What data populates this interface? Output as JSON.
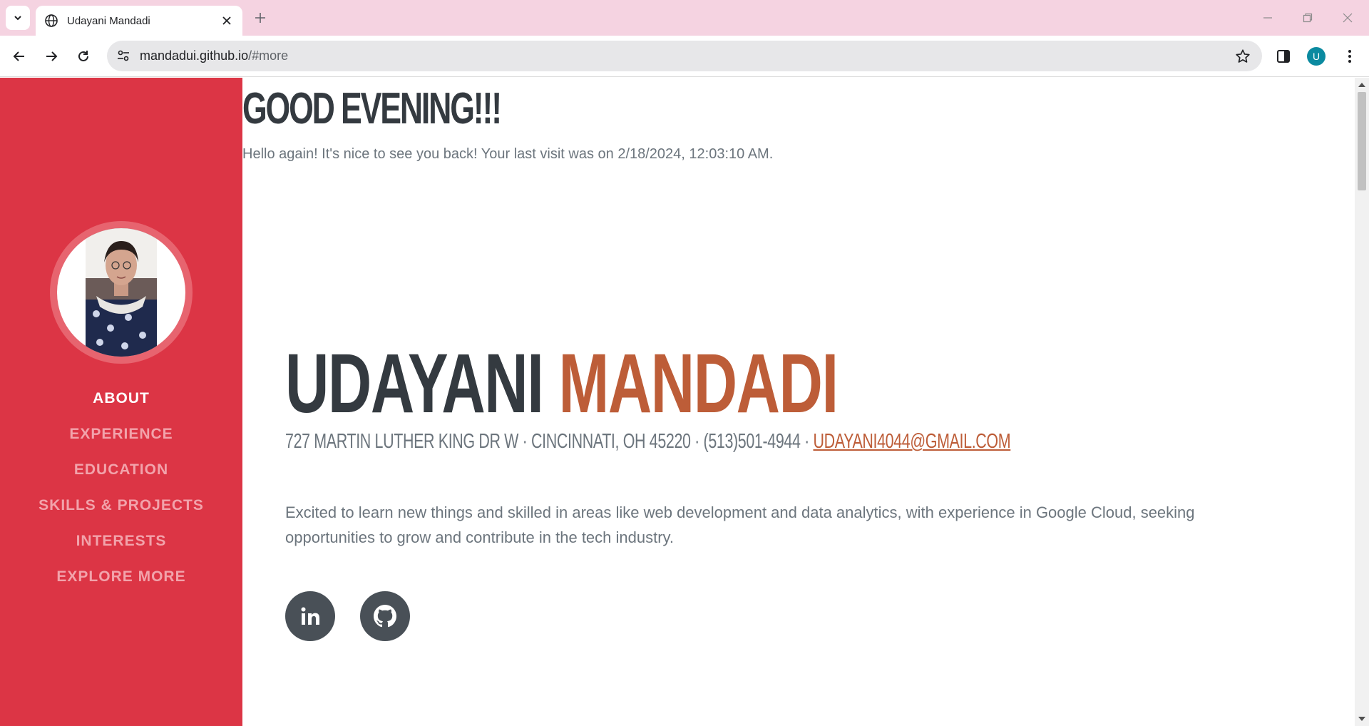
{
  "browser": {
    "tab_title": "Udayani Mandadi",
    "url_host": "mandadui.github.io",
    "url_path": "/#more",
    "profile_initial": "U"
  },
  "page": {
    "greeting": "GOOD EVENING!!!",
    "visit_message": "Hello again! It's nice to see you back! Your last visit was on 2/18/2024, 12:03:10 AM.",
    "first_name": "UDAYANI",
    "last_name": "MANDADI",
    "address": "727 MARTIN LUTHER KING DR W · CINCINNATI, OH 45220 · (513)501-4944 · ",
    "email": "UDAYANI4044@GMAIL.COM",
    "summary": "Excited to learn new things and skilled in areas like web development and data analytics, with experience in Google Cloud, seeking opportunities to grow and contribute in the tech industry."
  },
  "sidebar": {
    "items": [
      {
        "label": "ABOUT",
        "active": true
      },
      {
        "label": "EXPERIENCE"
      },
      {
        "label": "EDUCATION"
      },
      {
        "label": "SKILLS & PROJECTS"
      },
      {
        "label": "INTERESTS"
      },
      {
        "label": "EXPLORE MORE"
      }
    ]
  },
  "social": [
    {
      "icon": "linkedin-icon"
    },
    {
      "icon": "github-icon"
    }
  ],
  "colors": {
    "sidebar": "#dc3545",
    "accent": "#bd5d38",
    "heading": "#343a40",
    "body_text": "#6c757d",
    "tabbar": "#f5d3e1"
  }
}
